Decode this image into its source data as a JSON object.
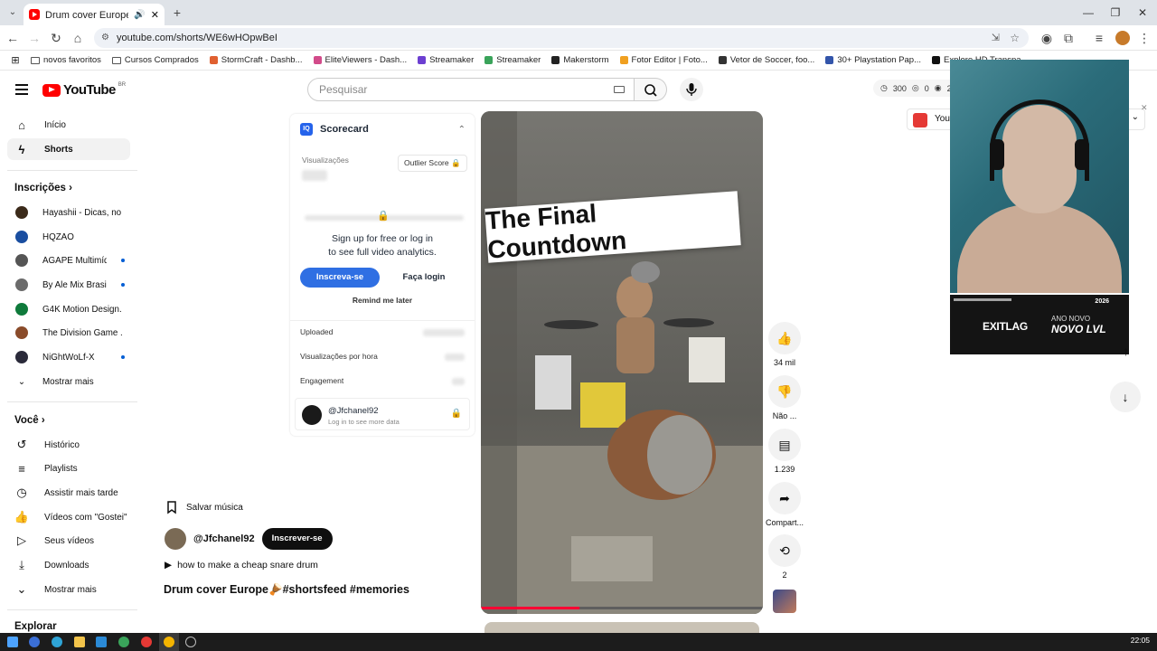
{
  "browser": {
    "tab_title": "Drum cover Europe🪘#sho",
    "url": "youtube.com/shorts/WE6wHOpwBeI",
    "bookmarks": [
      {
        "label": "novos favoritos",
        "type": "folder"
      },
      {
        "label": "Cursos Comprados",
        "type": "folder"
      },
      {
        "label": "StormCraft - Dashb...",
        "color": "#e06030"
      },
      {
        "label": "EliteViewers - Dash...",
        "color": "#d24b8a"
      },
      {
        "label": "Streamaker",
        "color": "#6c3fd1"
      },
      {
        "label": "Streamaker",
        "color": "#3aa35a"
      },
      {
        "label": "Makerstorm",
        "color": "#222222"
      },
      {
        "label": "Fotor Editor | Foto...",
        "color": "#f0a020"
      },
      {
        "label": "Vetor de Soccer, foo...",
        "color": "#333333"
      },
      {
        "label": "30+ Playstation Pap...",
        "color": "#3355aa"
      },
      {
        "label": "Explore HD Transpa...",
        "color": "#111111"
      }
    ]
  },
  "header": {
    "logo_text": "YouTube",
    "country": "BR",
    "search_placeholder": "Pesquisar",
    "stats": {
      "views": "300",
      "likes": "0",
      "followers": "26"
    }
  },
  "sidebar": {
    "home": "Início",
    "shorts": "Shorts",
    "subscriptions_heading": "Inscrições",
    "subscriptions": [
      {
        "name": "Hayashii - Dicas, no...",
        "color": "#3b2a1a",
        "dot": false
      },
      {
        "name": "HQZAO",
        "color": "#1a4ea0",
        "dot": false
      },
      {
        "name": "ÁGAPE Multimídia",
        "color": "#555555",
        "dot": true
      },
      {
        "name": "By Ale Mix Brasil",
        "color": "#6b6b6b",
        "dot": true
      },
      {
        "name": "G4K Motion Design...",
        "color": "#0f7a3b",
        "dot": false
      },
      {
        "name": "The Division Game ...",
        "color": "#8a4b2a",
        "dot": false
      },
      {
        "name": "NiGhtWoLf-X",
        "color": "#2a2a3a",
        "dot": true
      }
    ],
    "show_more": "Mostrar mais",
    "you_heading": "Você",
    "you_items": [
      {
        "label": "Histórico",
        "icon": "history-icon"
      },
      {
        "label": "Playlists",
        "icon": "playlists-icon"
      },
      {
        "label": "Assistir mais tarde",
        "icon": "watch-later-icon"
      },
      {
        "label": "Vídeos com \"Gostei\"",
        "icon": "liked-videos-icon"
      },
      {
        "label": "Seus vídeos",
        "icon": "your-videos-icon"
      },
      {
        "label": "Downloads",
        "icon": "downloads-icon"
      }
    ],
    "show_more_2": "Mostrar mais",
    "explore_heading": "Explorar"
  },
  "scorecard": {
    "title": "Scorecard",
    "views_label": "Visualizações",
    "outlier_label": "Outlier Score",
    "signup_line1": "Sign up for free or log in",
    "signup_line2": "to see full video analytics.",
    "subscribe_btn": "Inscreva-se",
    "login_btn": "Faça login",
    "remind": "Remind me later",
    "uploaded": "Uploaded",
    "views_per_hour": "Visualizações por hora",
    "engagement": "Engagement",
    "channel": "@Jfchanel92",
    "channel_sub": "Log in to see more data"
  },
  "video": {
    "overlay_text": "The Final Countdown",
    "progress": 0.35
  },
  "actions": {
    "likes": "34 mil",
    "dislike": "Não ...",
    "comments": "1.239",
    "share": "Compart...",
    "remix": "2"
  },
  "info": {
    "save_music": "Salvar música",
    "channel": "@Jfchanel92",
    "subscribe": "Inscrever-se",
    "snare": "how to make a cheap snare drum",
    "title": "Drum cover Europe🪘#shortsfeed #memories"
  },
  "overlay": {
    "chip_label": "You",
    "exitlag_logo": "EXITLAG",
    "exitlag_line1": "ANO NOVO",
    "exitlag_line2": "NOVO LVL",
    "exitlag_year": "2026"
  },
  "taskbar": {
    "time": "22:05"
  }
}
